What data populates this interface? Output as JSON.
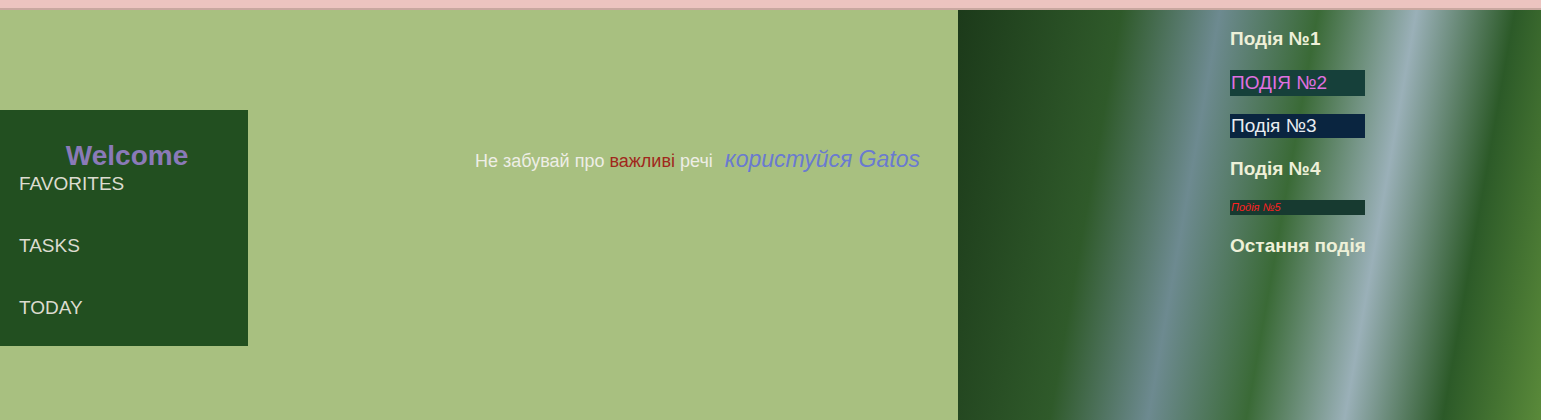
{
  "sidebar": {
    "title": "Welcome",
    "items": [
      "FAVORITES",
      "TASKS",
      "TODAY"
    ]
  },
  "tagline": {
    "before": "Не забувай про ",
    "highlight": "важливі",
    "after": " речі",
    "slogan": "користуйся Gatos"
  },
  "events": [
    {
      "label": "Подія №1",
      "kind": "bold",
      "color": "#eef0d8"
    },
    {
      "label": "ПОДІЯ №2",
      "kind": "boxed",
      "color": "#e070e0"
    },
    {
      "label": "Подія №3",
      "kind": "navy",
      "color": "#e8ecf0"
    },
    {
      "label": "Подія №4",
      "kind": "bold",
      "color": "#eef0d8"
    },
    {
      "label": "Подія №5",
      "kind": "small",
      "color": "#ff2020"
    },
    {
      "label": "Остання подія",
      "kind": "bold",
      "color": "#eef0d8"
    }
  ]
}
